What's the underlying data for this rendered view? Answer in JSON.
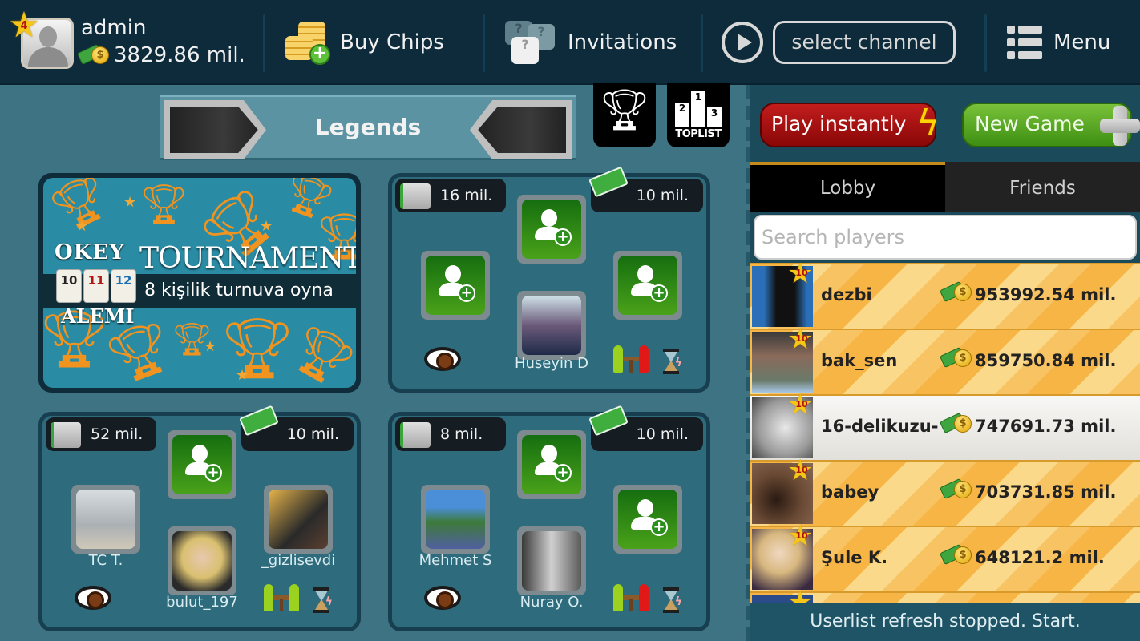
{
  "header": {
    "profile": {
      "username": "admin",
      "level": "4",
      "balance": "3829.86 mil."
    },
    "buy_chips_label": "Buy Chips",
    "invitations_label": "Invitations",
    "channel_placeholder": "select channel",
    "menu_label": "Menu"
  },
  "lobby": {
    "room_title": "Legends",
    "tournament": {
      "logo_top": "OKEY",
      "logo_bottom": "ALEMI",
      "tiles": [
        "10",
        "11",
        "12"
      ],
      "title": "TOURNAMENT",
      "subtitle": "8 kişilik turnuva oyna"
    },
    "tables": [
      {
        "pot": "16 mil.",
        "bet": "10 mil.",
        "seats": {
          "top": null,
          "left": null,
          "right": null,
          "bottom": "Huseyin D"
        }
      },
      {
        "pot": "52 mil.",
        "bet": "10 mil.",
        "seats": {
          "top": null,
          "left": "TC T.",
          "right": "_gizlisevdi",
          "bottom": "bulut_197"
        }
      },
      {
        "pot": "8 mil.",
        "bet": "10 mil.",
        "seats": {
          "top": null,
          "left": "Mehmet S",
          "right": null,
          "bottom": "Nuray O."
        }
      }
    ]
  },
  "sidebar": {
    "play_instantly_label": "Play instantly",
    "new_game_label": "New Game",
    "tabs": [
      {
        "label": "Lobby",
        "active": true
      },
      {
        "label": "Friends",
        "active": false
      }
    ],
    "search_placeholder": "Search players",
    "players": [
      {
        "name": "dezbi",
        "level": "10",
        "chips": "953992.54 mil.",
        "selected": false
      },
      {
        "name": "bak_sen",
        "level": "10",
        "chips": "859750.84 mil.",
        "selected": false
      },
      {
        "name": "16-delikuzu-",
        "level": "10",
        "chips": "747691.73 mil.",
        "selected": true
      },
      {
        "name": "babey",
        "level": "10",
        "chips": "703731.85 mil.",
        "selected": false
      },
      {
        "name": "Şule K.",
        "level": "10",
        "chips": "648121.2 mil.",
        "selected": false
      }
    ],
    "status_text": "Userlist refresh stopped. Start."
  },
  "colors": {
    "topbar_bg": "#0d2b3b",
    "page_bg": "#3e7384",
    "play_button": "#b01414",
    "new_game_button": "#5aa82a",
    "active_tab_accent": "#c58b1c",
    "empty_seat": "#2e8a16"
  }
}
